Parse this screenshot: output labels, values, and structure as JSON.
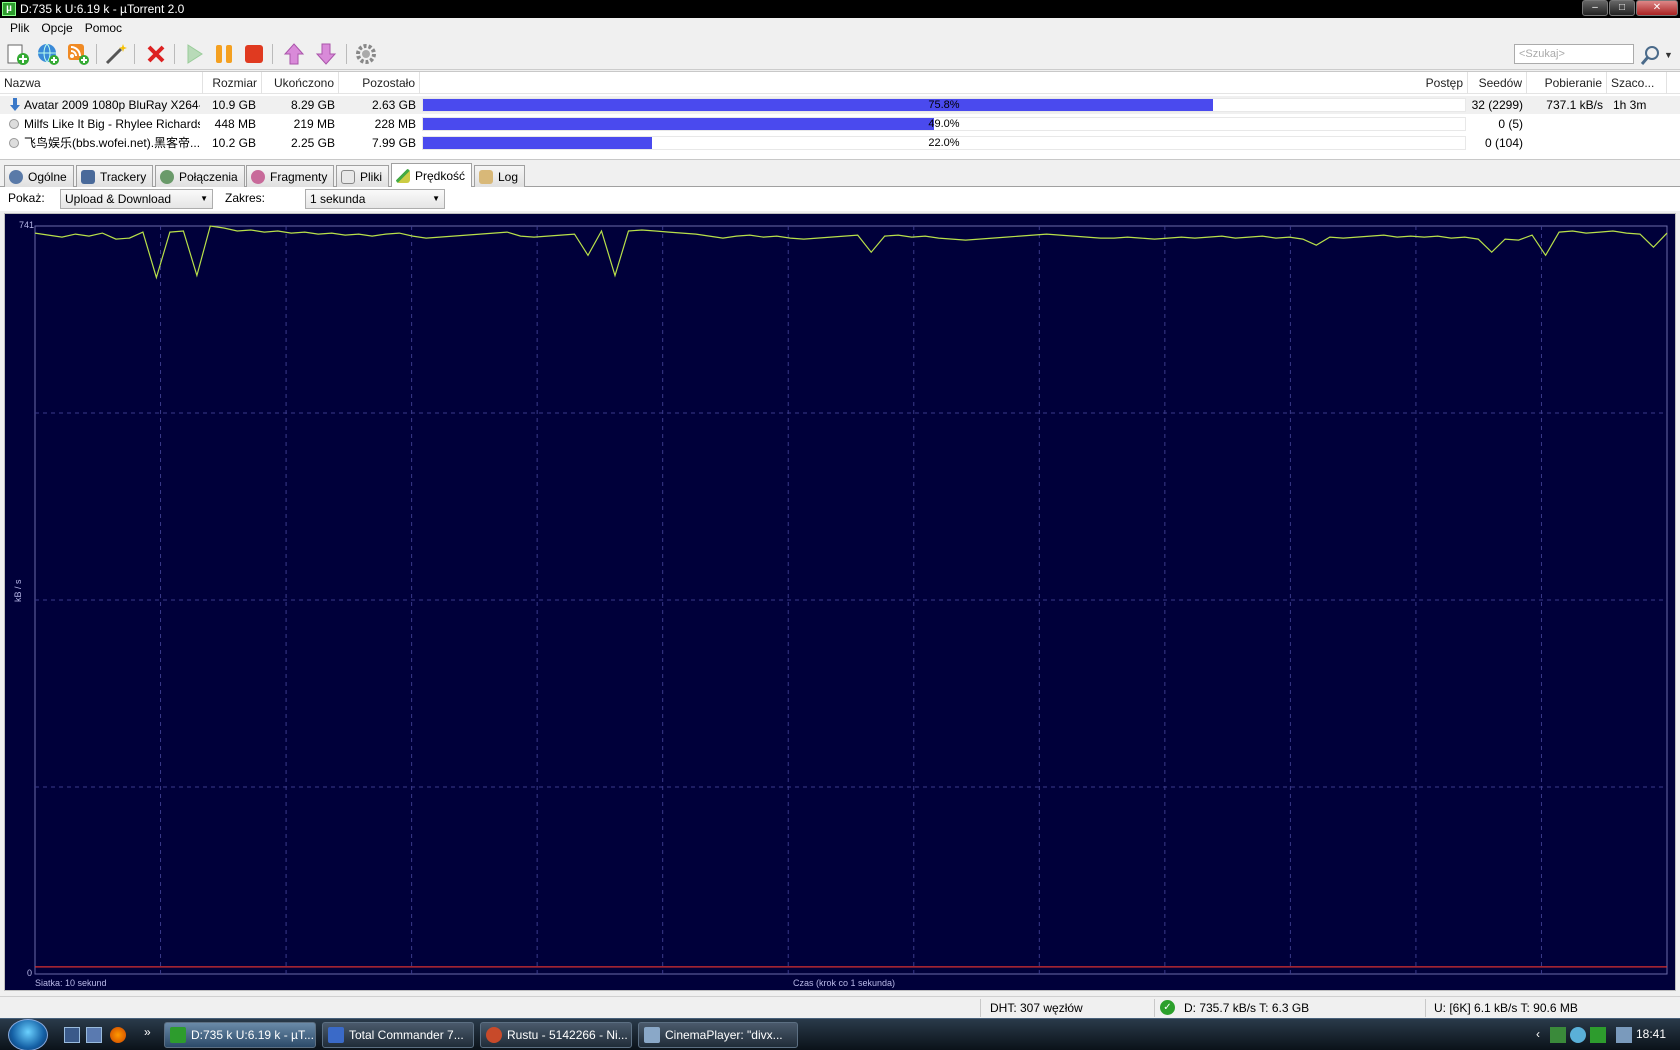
{
  "window": {
    "title": "D:735 k U:6.19 k - µTorrent 2.0",
    "app_icon": "µ"
  },
  "menu": [
    "Plik",
    "Opcje",
    "Pomoc"
  ],
  "toolbar": {
    "icons": [
      "add-torrent-icon",
      "add-url-icon",
      "add-rss-icon",
      "create-torrent-icon",
      "remove-icon",
      "start-icon",
      "pause-icon",
      "stop-icon",
      "move-up-icon",
      "move-down-icon",
      "preferences-icon"
    ],
    "search_placeholder": "<Szukaj>"
  },
  "list": {
    "columns": [
      "Nazwa",
      "Rozmiar",
      "Ukończono",
      "Pozostało",
      "Postęp",
      "Seedów",
      "Pobieranie",
      "Szaco..."
    ],
    "rows": [
      {
        "name": "Avatar 2009 1080p BluRay X264-...",
        "size": "10.9 GB",
        "done": "8.29 GB",
        "remaining": "2.63 GB",
        "progress": 0.758,
        "progress_text": "75.8%",
        "seeds": "32 (2299)",
        "down": "737.1 kB/s",
        "eta": "1h 3m",
        "status": "downloading"
      },
      {
        "name": "Milfs Like It Big - Rhylee Richards",
        "size": "448 MB",
        "done": "219 MB",
        "remaining": "228 MB",
        "progress": 0.49,
        "progress_text": "49.0%",
        "seeds": "0 (5)",
        "down": "",
        "eta": "",
        "status": "queued"
      },
      {
        "name": "飞鸟娱乐(bbs.wofei.net).黑客帝...",
        "size": "10.2 GB",
        "done": "2.25 GB",
        "remaining": "7.99 GB",
        "progress": 0.22,
        "progress_text": "22.0%",
        "seeds": "0 (104)",
        "down": "",
        "eta": "",
        "status": "queued"
      }
    ]
  },
  "tabs": [
    "Ogólne",
    "Trackery",
    "Połączenia",
    "Fragmenty",
    "Pliki",
    "Prędkość",
    "Log"
  ],
  "active_tab": "Prędkość",
  "controls": {
    "show_label": "Pokaż:",
    "show_value": "Upload & Download",
    "range_label": "Zakres:",
    "range_value": "1 sekunda"
  },
  "chart_data": {
    "type": "line",
    "ylabel": "kB / s",
    "ylim": [
      0,
      741
    ],
    "y_ticks": [
      "741",
      "0"
    ],
    "grid_note": "Siatka: 10 sekund",
    "xlabel": "Czas (krok co 1 sekunda)",
    "grid": true,
    "series": [
      {
        "color": "#b8e04a",
        "values": [
          734,
          732,
          730,
          733,
          731,
          734,
          728,
          729,
          735,
          690,
          735,
          736,
          692,
          741,
          739,
          736,
          737,
          735,
          736,
          734,
          735,
          733,
          734,
          732,
          733,
          731,
          733,
          734,
          731,
          729,
          730,
          731,
          732,
          733,
          734,
          735,
          731,
          730,
          731,
          732,
          733,
          712,
          736,
          692,
          736,
          737,
          736,
          735,
          734,
          733,
          731,
          729,
          731,
          732,
          730,
          731,
          729,
          728,
          729,
          730,
          731,
          732,
          715,
          731,
          732,
          730,
          731,
          729,
          728,
          727,
          728,
          729,
          730,
          731,
          732,
          733,
          732,
          731,
          730,
          729,
          729,
          730,
          729,
          728,
          729,
          730,
          729,
          730,
          731,
          729,
          730,
          731,
          729,
          730,
          728,
          722,
          730,
          729,
          730,
          731,
          732,
          730,
          731,
          730,
          731,
          729,
          730,
          728,
          715,
          728,
          727,
          732,
          712,
          735,
          736,
          734,
          735,
          736,
          734,
          733,
          720,
          734
        ]
      },
      {
        "color": "#d83030",
        "values": [
          7,
          7,
          7,
          7,
          7,
          7,
          7,
          7,
          7,
          7,
          7,
          7,
          7,
          7,
          7,
          7,
          7,
          7,
          7,
          7,
          7,
          7,
          7,
          7,
          7,
          7,
          7,
          7,
          7,
          7,
          7,
          7,
          7,
          7,
          7,
          7,
          7,
          7,
          7,
          7,
          7,
          7,
          7,
          7,
          7,
          7,
          7,
          7,
          7,
          7,
          7,
          7,
          7,
          7,
          7,
          7,
          7,
          7,
          7,
          7,
          7,
          7,
          7,
          7,
          7,
          7,
          7,
          7,
          7,
          7,
          7,
          7,
          7,
          7,
          7,
          7,
          7,
          7,
          7,
          7,
          7,
          7,
          7,
          7,
          7,
          7,
          7,
          7,
          7,
          7,
          7,
          7,
          7,
          7,
          7,
          7,
          7,
          7,
          7,
          7,
          7,
          7,
          7,
          7,
          7,
          7,
          7,
          7,
          7,
          7,
          7,
          7,
          7,
          7,
          7,
          7,
          7,
          7,
          7,
          7,
          7,
          7
        ]
      }
    ]
  },
  "statusbar": {
    "dht": "DHT: 307 węzłów",
    "download": "D: 735.7 kB/s T: 6.3 GB",
    "upload": "U: [6K] 6.1 kB/s T: 90.6 MB"
  },
  "taskbar": {
    "tasks": [
      "D:735 k U:6.19 k - µT...",
      "Total Commander 7...",
      "Rustu - 5142266 - Ni...",
      "CinemaPlayer: \"divx..."
    ],
    "more": "»",
    "tray_chevron": "‹",
    "clock": "18:41"
  }
}
